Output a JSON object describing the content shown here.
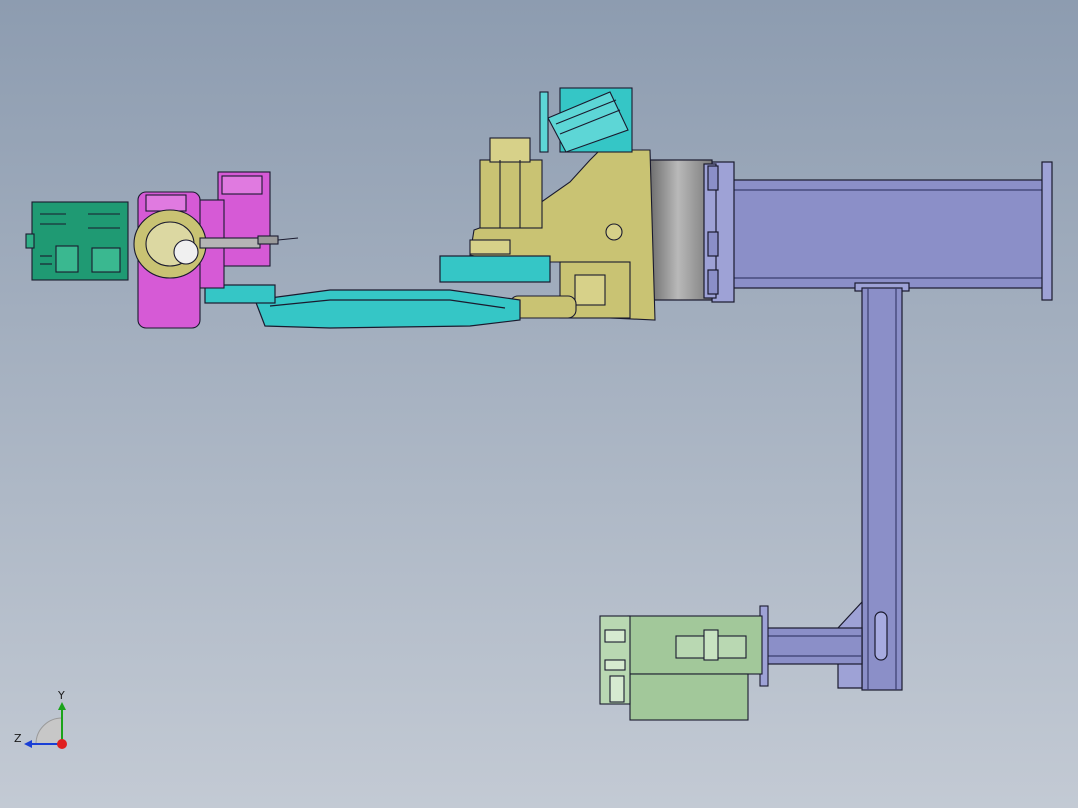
{
  "viewport": {
    "background_top": "#8d9cb0",
    "background_bottom": "#c3cad4"
  },
  "model": {
    "colors": {
      "frame": "#8b8fc8",
      "motor": "#a2c89a",
      "base": "#c9c373",
      "arm": "#35c6c6",
      "wrist": "#d65ad6",
      "controller": "#1f9a73",
      "drum": "#8a8a8a",
      "edge": "#1a1a2e"
    }
  },
  "triad": {
    "y_label": "Y",
    "z_label": "Z",
    "y_color": "#1aa31a",
    "z_color": "#1a3fd6",
    "origin_color": "#e01f1f",
    "icon": "axis-triad-icon"
  }
}
